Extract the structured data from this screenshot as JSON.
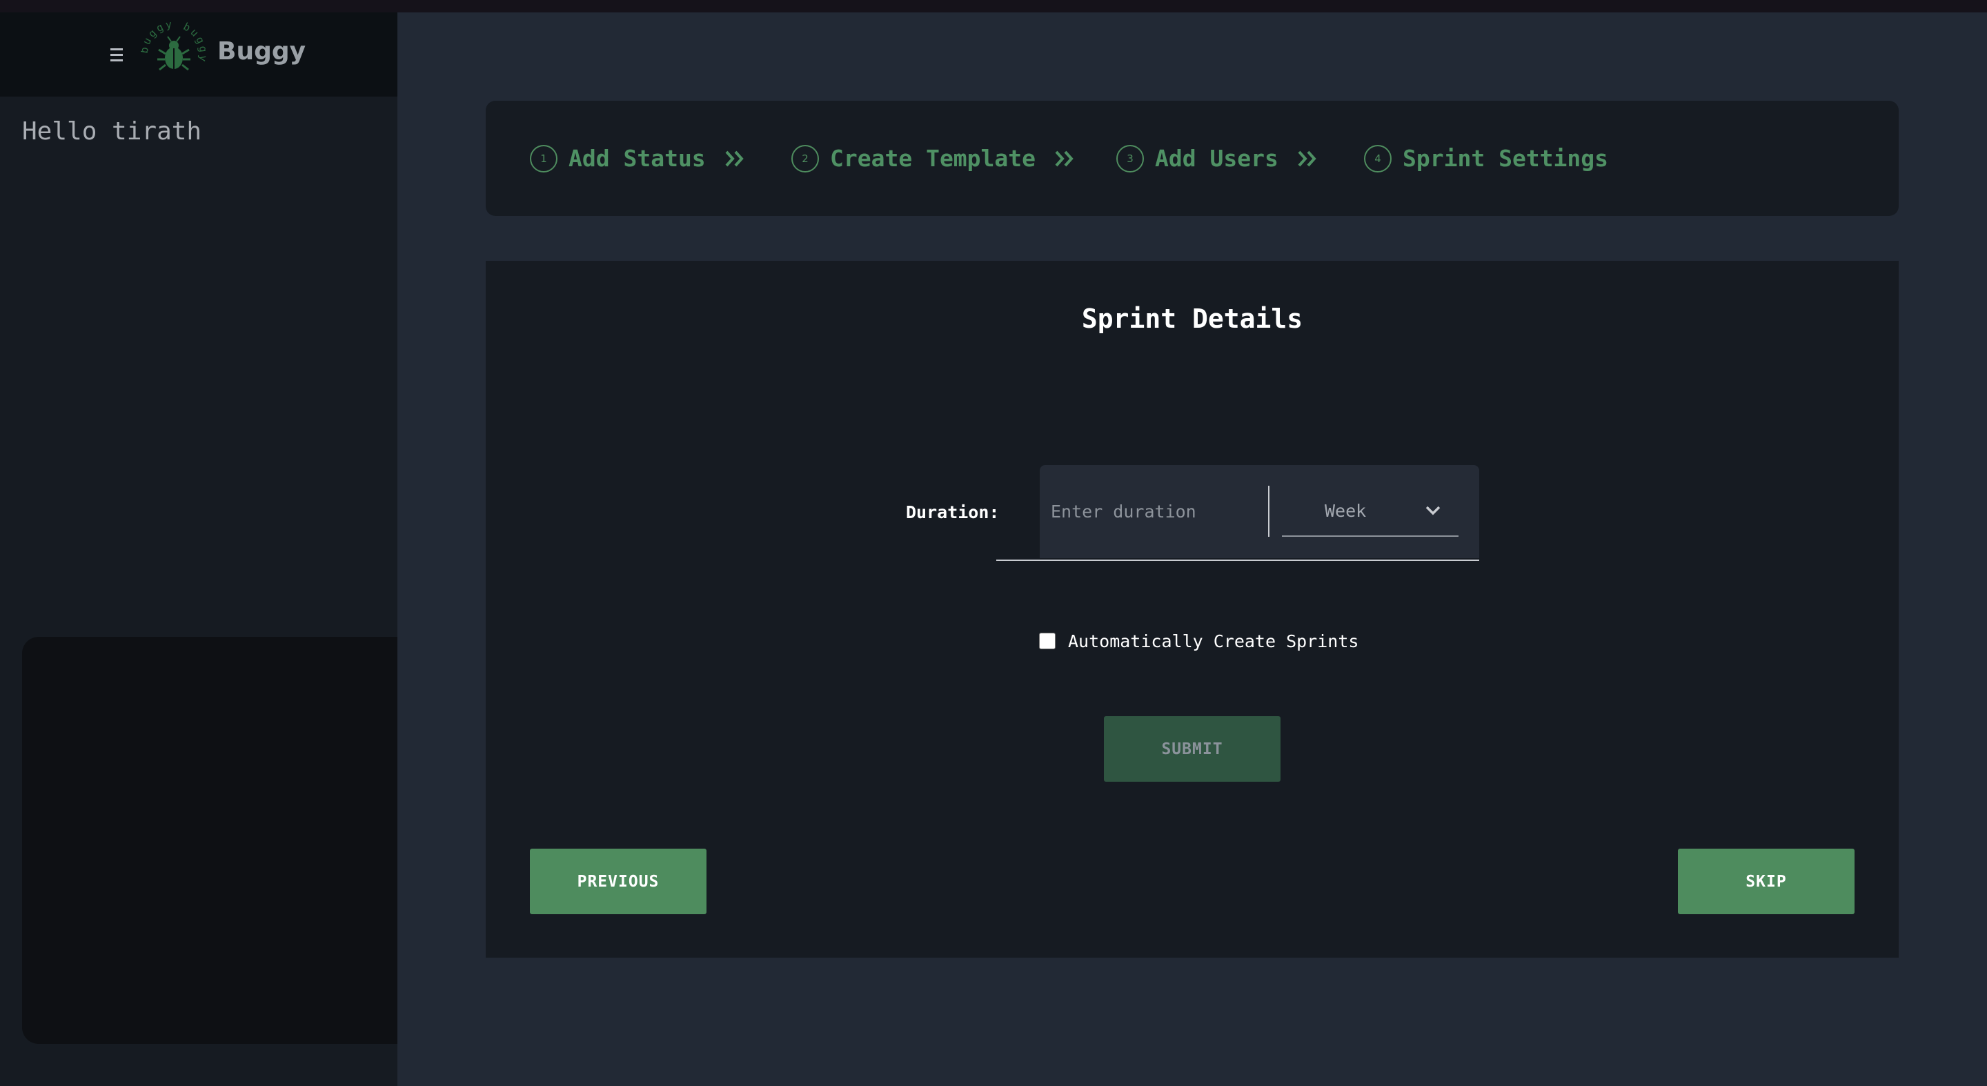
{
  "sidebar": {
    "app_name": "Buggy",
    "logo_text": "buggy buggy",
    "greeting": "Hello tirath"
  },
  "stepper": {
    "steps": [
      {
        "number": "1",
        "label": "Add Status"
      },
      {
        "number": "2",
        "label": "Create Template"
      },
      {
        "number": "3",
        "label": "Add Users"
      },
      {
        "number": "4",
        "label": "Sprint Settings"
      }
    ]
  },
  "form": {
    "title": "Sprint Details",
    "duration_label": "Duration:",
    "duration_placeholder": "Enter duration",
    "duration_value": "",
    "unit_selected": "Week",
    "auto_create_label": "Automatically Create Sprints",
    "auto_create_checked": false,
    "submit_label": "SUBMIT"
  },
  "nav": {
    "previous_label": "PREVIOUS",
    "skip_label": "SKIP"
  },
  "colors": {
    "accent": "#4e8c5e",
    "accent_dim": "#2f5541",
    "page_bg": "#222935",
    "card_bg": "#161b22"
  },
  "icons": {
    "menu": "hamburger-icon",
    "logo": "bug-icon",
    "step_separator": "double-chevron-right-icon",
    "dropdown": "chevron-down-icon"
  }
}
